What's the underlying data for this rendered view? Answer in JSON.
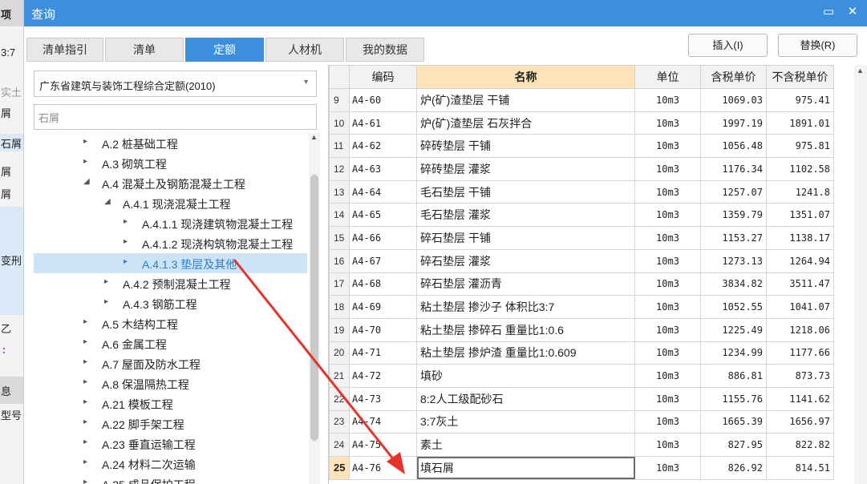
{
  "background_strip": {
    "items": [
      "项",
      "3:7",
      "实土",
      "屑",
      "石屑",
      "屑",
      "屑",
      "变刑",
      "乙",
      ":",
      "息",
      "型号"
    ]
  },
  "dialog": {
    "title": "查询",
    "minimize_glyph": "▭",
    "close_glyph": "✕"
  },
  "tabs": [
    {
      "label": "清单指引"
    },
    {
      "label": "清单"
    },
    {
      "label": "定额"
    },
    {
      "label": "人材机"
    },
    {
      "label": "我的数据"
    }
  ],
  "actions": {
    "insert_label": "插入(I)",
    "replace_label": "替换(R)"
  },
  "quota_select": {
    "value": "广东省建筑与装饰工程综合定额(2010)"
  },
  "search": {
    "value": "石屑"
  },
  "tree": [
    {
      "label": "A.2 桩基础工程",
      "level": 0,
      "toggle": "▸"
    },
    {
      "label": "A.3 砌筑工程",
      "level": 0,
      "toggle": "▸"
    },
    {
      "label": "A.4 混凝土及钢筋混凝土工程",
      "level": 0,
      "toggle": "◢"
    },
    {
      "label": "A.4.1 现浇混凝土工程",
      "level": 1,
      "toggle": "◢"
    },
    {
      "label": "A.4.1.1 现浇建筑物混凝土工程",
      "level": 2,
      "toggle": "▸"
    },
    {
      "label": "A.4.1.2 现浇构筑物混凝土工程",
      "level": 2,
      "toggle": "▸"
    },
    {
      "label": "A.4.1.3 垫层及其他",
      "level": 2,
      "toggle": "▸",
      "selected": true
    },
    {
      "label": "A.4.2 预制混凝土工程",
      "level": 1,
      "toggle": "▸"
    },
    {
      "label": "A.4.3 钢筋工程",
      "level": 1,
      "toggle": "▸"
    },
    {
      "label": "A.5 木结构工程",
      "level": 0,
      "toggle": "▸"
    },
    {
      "label": "A.6 金属工程",
      "level": 0,
      "toggle": "▸"
    },
    {
      "label": "A.7 屋面及防水工程",
      "level": 0,
      "toggle": "▸"
    },
    {
      "label": "A.8 保温隔热工程",
      "level": 0,
      "toggle": "▸"
    },
    {
      "label": "A.21 模板工程",
      "level": 0,
      "toggle": "▸"
    },
    {
      "label": "A.22 脚手架工程",
      "level": 0,
      "toggle": "▸"
    },
    {
      "label": "A.23 垂直运输工程",
      "level": 0,
      "toggle": "▸"
    },
    {
      "label": "A.24 材料二次运输",
      "level": 0,
      "toggle": "▸"
    },
    {
      "label": "A.25 成品保护工程",
      "level": 0,
      "toggle": "▸"
    }
  ],
  "table": {
    "headers": [
      "编码",
      "名称",
      "单位",
      "含税单价",
      "不含税单价"
    ],
    "rows": [
      {
        "idx": "9",
        "code": "A4-60",
        "name": "炉(矿)渣垫层 干铺",
        "unit": "10m3",
        "tax_price": "1069.03",
        "notax_price": "975.41"
      },
      {
        "idx": "10",
        "code": "A4-61",
        "name": "炉(矿)渣垫层 石灰拌合",
        "unit": "10m3",
        "tax_price": "1997.19",
        "notax_price": "1891.01"
      },
      {
        "idx": "11",
        "code": "A4-62",
        "name": "碎砖垫层 干铺",
        "unit": "10m3",
        "tax_price": "1056.48",
        "notax_price": "975.81"
      },
      {
        "idx": "12",
        "code": "A4-63",
        "name": "碎砖垫层 灌浆",
        "unit": "10m3",
        "tax_price": "1176.34",
        "notax_price": "1102.58"
      },
      {
        "idx": "13",
        "code": "A4-64",
        "name": "毛石垫层 干铺",
        "unit": "10m3",
        "tax_price": "1257.07",
        "notax_price": "1241.8"
      },
      {
        "idx": "14",
        "code": "A4-65",
        "name": "毛石垫层 灌浆",
        "unit": "10m3",
        "tax_price": "1359.79",
        "notax_price": "1351.07"
      },
      {
        "idx": "15",
        "code": "A4-66",
        "name": "碎石垫层 干铺",
        "unit": "10m3",
        "tax_price": "1153.27",
        "notax_price": "1138.17"
      },
      {
        "idx": "16",
        "code": "A4-67",
        "name": "碎石垫层 灌浆",
        "unit": "10m3",
        "tax_price": "1273.13",
        "notax_price": "1264.94"
      },
      {
        "idx": "17",
        "code": "A4-68",
        "name": "碎石垫层 灌沥青",
        "unit": "10m3",
        "tax_price": "3834.82",
        "notax_price": "3511.47"
      },
      {
        "idx": "18",
        "code": "A4-69",
        "name": "粘土垫层 掺沙子 体积比3:7",
        "unit": "10m3",
        "tax_price": "1052.55",
        "notax_price": "1041.07"
      },
      {
        "idx": "19",
        "code": "A4-70",
        "name": "粘土垫层 掺碎石 重量比1:0.6",
        "unit": "10m3",
        "tax_price": "1225.49",
        "notax_price": "1218.06"
      },
      {
        "idx": "20",
        "code": "A4-71",
        "name": "粘土垫层 掺炉渣 重量比1:0.609",
        "unit": "10m3",
        "tax_price": "1234.99",
        "notax_price": "1177.66"
      },
      {
        "idx": "21",
        "code": "A4-72",
        "name": "填砂",
        "unit": "10m3",
        "tax_price": "886.81",
        "notax_price": "873.73"
      },
      {
        "idx": "22",
        "code": "A4-73",
        "name": "8:2人工级配砂石",
        "unit": "10m3",
        "tax_price": "1155.76",
        "notax_price": "1141.62"
      },
      {
        "idx": "23",
        "code": "A4-74",
        "name": "3:7灰土",
        "unit": "10m3",
        "tax_price": "1665.39",
        "notax_price": "1656.97"
      },
      {
        "idx": "24",
        "code": "A4-75",
        "name": "素土",
        "unit": "10m3",
        "tax_price": "827.95",
        "notax_price": "822.82"
      },
      {
        "idx": "25",
        "code": "A4-76",
        "name": "填石屑",
        "unit": "10m3",
        "tax_price": "826.92",
        "notax_price": "814.51",
        "current": true
      }
    ]
  },
  "colors": {
    "accent": "#3c8fdc",
    "header_highlight": "#fce4b8",
    "tree_selected": "#cde4f7",
    "annotation_arrow": "#e8332a"
  }
}
